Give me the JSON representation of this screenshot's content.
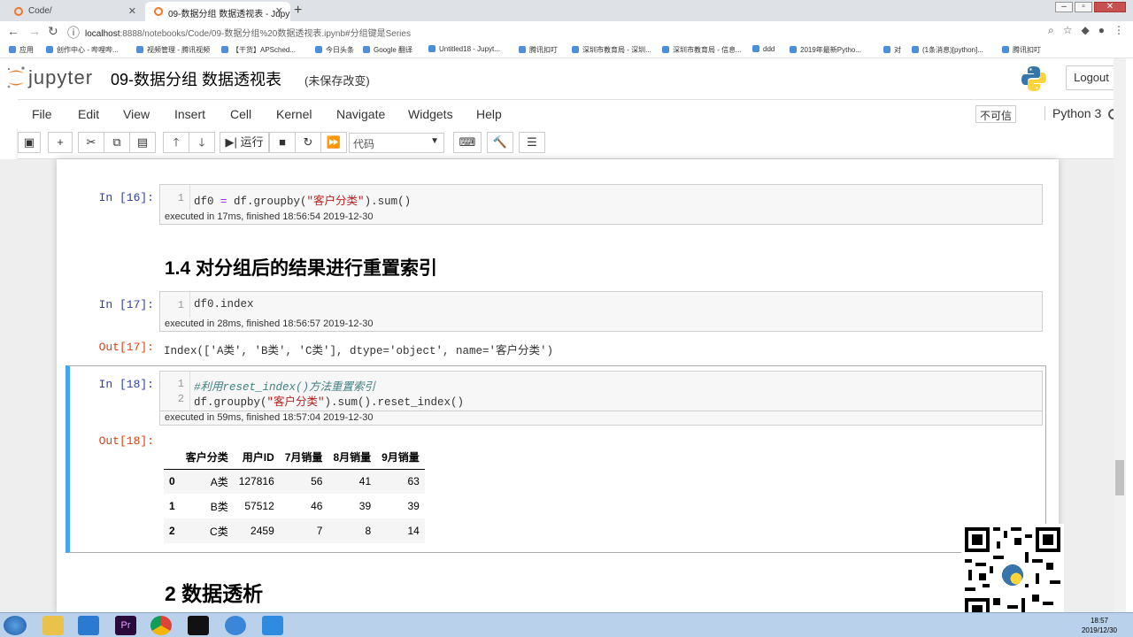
{
  "browser": {
    "tabs": [
      {
        "title": "Code/"
      },
      {
        "title": "09-数据分组 数据透视表 - Jupyt"
      }
    ],
    "url_host": "localhost",
    "url_rest": ":8888/notebooks/Code/09-数据分组%20数据透视表.ipynb#分组键是Series",
    "bookmarks": [
      "应用",
      "创作中心 - 哔哩哔...",
      "视频管理 - 腾讯视频",
      "【干货】APSched...",
      "今日头条",
      "Google 翻译",
      "Untitled18 - Jupyt...",
      "腾讯扣叮",
      "深圳市教育局 - 深圳...",
      "深圳市教育局 - 信息...",
      "ddd",
      "2019年最新Pytho...",
      "对",
      "(1条消息)[python]...",
      "腾讯扣叮"
    ]
  },
  "jupyter": {
    "logo_text": "jupyter",
    "notebook_title": "09-数据分组 数据透视表",
    "save_status": "(未保存改变)",
    "logout_label": "Logout",
    "menu": [
      "File",
      "Edit",
      "View",
      "Insert",
      "Cell",
      "Kernel",
      "Navigate",
      "Widgets",
      "Help"
    ],
    "trusted_label": "不可信",
    "kernel_name": "Python 3",
    "toolbar": {
      "run_label": "运行",
      "cell_type": "代码"
    }
  },
  "cells": {
    "c16": {
      "prompt": "In  [16]:",
      "line_no": "1",
      "code_a": "df0 ",
      "code_eq": "=",
      "code_b": " df.groupby(",
      "code_str": "\"客户分类\"",
      "code_c": ").sum()",
      "exec": "executed in 17ms, finished 18:56:54 2019-12-30"
    },
    "h14": "1.4  对分组后的结果进行重置索引",
    "c17": {
      "prompt": "In  [17]:",
      "line_no": "1",
      "code": "df0.index",
      "exec": "executed in 28ms, finished 18:56:57 2019-12-30",
      "out_prompt": "Out[17]:",
      "output": "Index(['A类', 'B类', 'C类'], dtype='object', name='客户分类')"
    },
    "c18": {
      "prompt": "In  [18]:",
      "line1_no": "1",
      "line2_no": "2",
      "comment": "#利用reset_index()方法重置索引",
      "code_a": "df.groupby(",
      "code_str": "\"客户分类\"",
      "code_b": ").sum().reset_index()",
      "exec": "executed in 59ms, finished 18:57:04 2019-12-30",
      "out_prompt": "Out[18]:"
    },
    "h2": "2  数据透析"
  },
  "dataframe": {
    "columns": [
      "",
      "客户分类",
      "用户ID",
      "7月销量",
      "8月销量",
      "9月销量"
    ],
    "rows": [
      [
        "0",
        "A类",
        "127816",
        "56",
        "41",
        "63"
      ],
      [
        "1",
        "B类",
        "57512",
        "46",
        "39",
        "39"
      ],
      [
        "2",
        "C类",
        "2459",
        "7",
        "8",
        "14"
      ]
    ]
  },
  "taskbar": {
    "time": "18:57",
    "date": "2019/12/30"
  }
}
